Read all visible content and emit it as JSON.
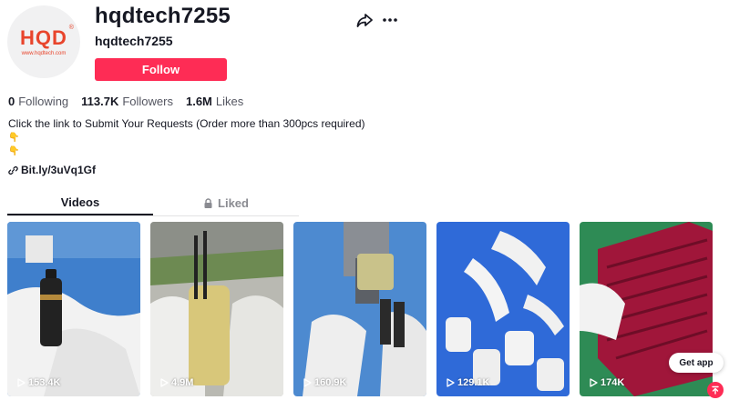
{
  "profile": {
    "avatar": {
      "logo_text": "HQD",
      "logo_reg": "®",
      "logo_url": "www.hqdtech.com"
    },
    "username": "hqdtech7255",
    "nickname": "hqdtech7255",
    "follow_label": "Follow",
    "stats": {
      "following_count": "0",
      "following_label": "Following",
      "followers_count": "113.7K",
      "followers_label": "Followers",
      "likes_count": "1.6M",
      "likes_label": "Likes"
    },
    "bio": {
      "line1": "Click the link to Submit Your Requests (Order more than 300pcs required)",
      "emoji1": "👇",
      "emoji2": "👇"
    },
    "link": "Bit.ly/3uVq1Gf"
  },
  "tabs": [
    {
      "label": "Videos",
      "active": true
    },
    {
      "label": "Liked",
      "active": false,
      "icon": "lock-icon"
    }
  ],
  "videos": [
    {
      "views": "153.4K"
    },
    {
      "views": "4.9M"
    },
    {
      "views": "160.9K"
    },
    {
      "views": "129.1K"
    },
    {
      "views": "174K"
    }
  ],
  "actions": {
    "get_app_label": "Get app"
  },
  "colors": {
    "accent": "#fe2c55",
    "logo": "#e8452c"
  }
}
